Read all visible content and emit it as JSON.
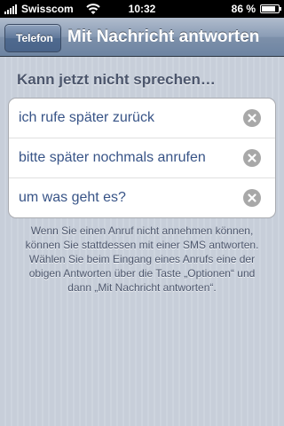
{
  "status_bar": {
    "carrier": "Swisscom",
    "time": "10:32",
    "battery_text": "86 %",
    "battery_level": 0.86,
    "icons": [
      "signal-bars-icon",
      "wifi-icon",
      "battery-icon"
    ]
  },
  "nav": {
    "back_label": "Telefon",
    "title": "Mit Nachricht antworten"
  },
  "section": {
    "header": "Kann jetzt nicht sprechen…",
    "items": [
      {
        "label": "ich rufe später zurück",
        "icon": "clear-icon"
      },
      {
        "label": "bitte später nochmals anrufen",
        "icon": "clear-icon"
      },
      {
        "label": "um was geht es?",
        "icon": "clear-icon"
      }
    ]
  },
  "footer": {
    "text": "Wenn Sie einen Anruf nicht annehmen können, können Sie stattdessen mit einer SMS antworten. Wählen Sie beim Eingang eines Anrufs eine der obigen Antworten über die Taste „Optionen“ und dann „Mit Nachricht antworten“."
  },
  "colors": {
    "nav_bar": "#7d90aa",
    "row_text": "#385487",
    "header_text": "#4c566c",
    "background": "#c7ced9"
  }
}
